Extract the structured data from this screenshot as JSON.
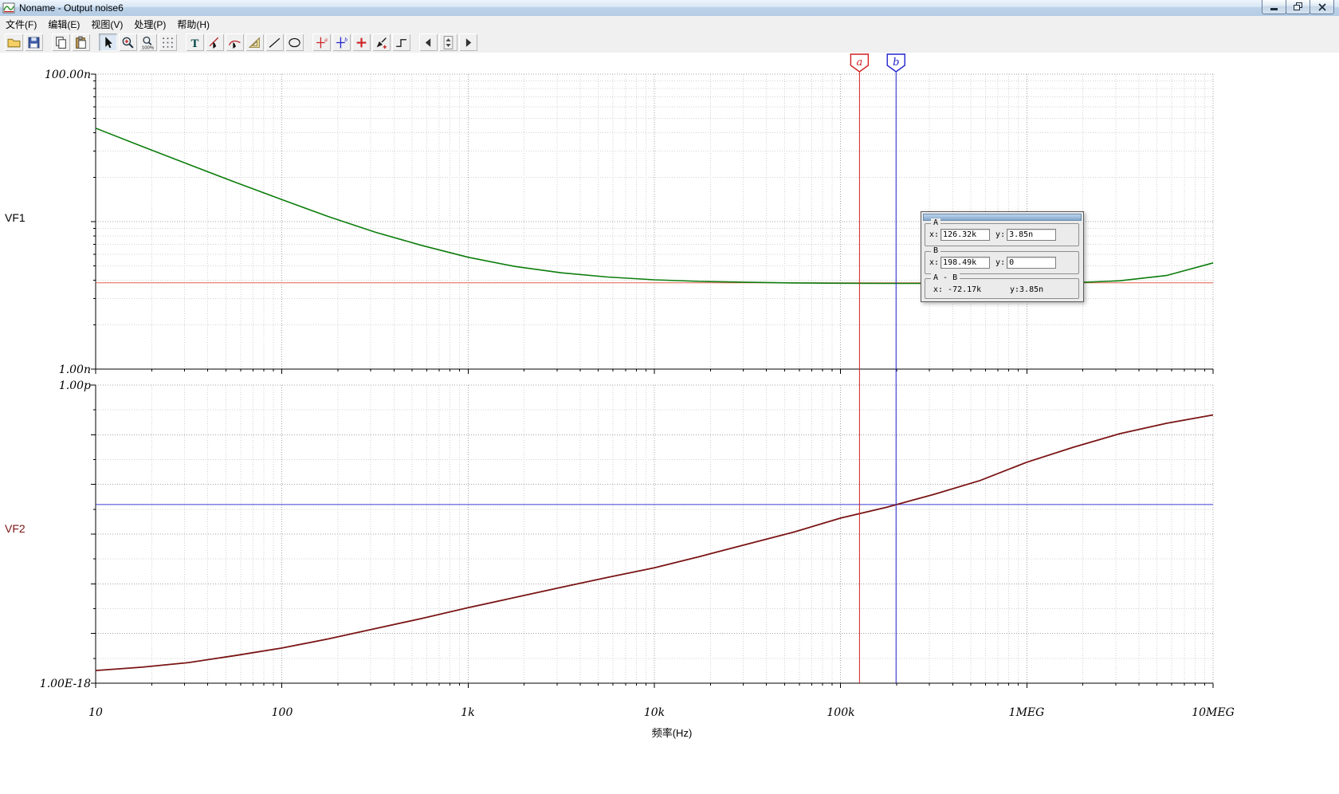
{
  "window": {
    "title": "Noname - Output noise6"
  },
  "menu": {
    "items": [
      {
        "id": "file",
        "label": "文件(F)"
      },
      {
        "id": "edit",
        "label": "编辑(E)"
      },
      {
        "id": "view",
        "label": "视图(V)"
      },
      {
        "id": "process",
        "label": "处理(P)"
      },
      {
        "id": "help",
        "label": "帮助(H)"
      }
    ]
  },
  "toolbar": {
    "groups": [
      [
        {
          "name": "open-button",
          "icon": "folder"
        },
        {
          "name": "save-button",
          "icon": "floppy"
        }
      ],
      [
        {
          "name": "copy-button",
          "icon": "copy"
        },
        {
          "name": "paste-button",
          "icon": "paste"
        }
      ],
      [
        {
          "name": "select-tool-button",
          "icon": "arrow",
          "pressed": true
        },
        {
          "name": "zoom-in-button",
          "icon": "zoom-in"
        },
        {
          "name": "zoom-100-button",
          "icon": "zoom-100"
        },
        {
          "name": "grid-toggle-button",
          "icon": "grid"
        }
      ],
      [
        {
          "name": "text-tool-button",
          "icon": "text"
        },
        {
          "name": "cursor-line-tool-button",
          "icon": "pointer-line"
        },
        {
          "name": "cursor-trace-tool-button",
          "icon": "pointer-curve"
        },
        {
          "name": "ruler-tool-button",
          "icon": "ruler"
        },
        {
          "name": "line-tool-button",
          "icon": "line"
        },
        {
          "name": "ellipse-tool-button",
          "icon": "ellipse"
        }
      ],
      [
        {
          "name": "cursor-a-button",
          "icon": "cursor-a"
        },
        {
          "name": "cursor-b-button",
          "icon": "cursor-b"
        },
        {
          "name": "add-marker-button",
          "icon": "add-marker"
        },
        {
          "name": "pen-tool-button",
          "icon": "pen"
        },
        {
          "name": "step-tool-button",
          "icon": "step"
        }
      ],
      [
        {
          "name": "prev-page-button",
          "icon": "prev"
        },
        {
          "name": "page-spinner",
          "icon": "spinner"
        },
        {
          "name": "next-page-button",
          "icon": "next"
        }
      ]
    ]
  },
  "plots": {
    "vf1_label": "VF1",
    "vf2_label": "VF2",
    "y_labels": {
      "vf1_top": "100.00n",
      "vf1_bottom": "1.00n",
      "vf2_top": "1.00p",
      "vf2_bottom": "1.00E-18"
    },
    "x_ticks": [
      "10",
      "100",
      "1k",
      "10k",
      "100k",
      "1MEG",
      "10MEG"
    ],
    "x_label": "频率(Hz)"
  },
  "cursors": {
    "a": {
      "label": "a",
      "freq": 126320,
      "value": 3.85e-09,
      "color": "#d02020",
      "hline_color": "#e0614f"
    },
    "b": {
      "label": "b",
      "freq": 198490,
      "value": 3.94e-15,
      "color": "#2424cf",
      "hline_color": "#3c3cd6"
    }
  },
  "cursor_panel": {
    "a": {
      "label": "A",
      "x_label": "x:",
      "x": "126.32k",
      "y_label": "y:",
      "y": "3.85n"
    },
    "b": {
      "label": "B",
      "x_label": "x:",
      "x": "198.49k",
      "y_label": "y:",
      "y": "0"
    },
    "diff": {
      "label": "A - B",
      "x_text": "x: -72.17k",
      "y_text": "y:3.85n"
    }
  },
  "chart_data": [
    {
      "type": "line",
      "title": "VF1 output noise spectral density",
      "x_scale": "log",
      "y_scale": "log",
      "x_range": [
        10,
        10000000
      ],
      "y_range": [
        1e-09,
        1e-07
      ],
      "x_ticks": [
        "10",
        "100",
        "1k",
        "10k",
        "100k",
        "1MEG",
        "10MEG"
      ],
      "y_ticks": [
        "1.00n",
        "100.00n"
      ],
      "xlabel": "频率(Hz)",
      "ylabel": "VF1",
      "grid": "log-dotted",
      "series": [
        {
          "name": "VF1",
          "color": "#0c7d0c",
          "x": [
            10,
            17.8,
            31.6,
            56.2,
            100,
            178,
            316,
            562,
            1000,
            1780,
            3160,
            5620,
            10000,
            17800,
            31600,
            56200,
            100000,
            178000,
            316000,
            562000,
            1000000,
            1780000,
            3160000,
            5620000,
            10000000
          ],
          "y": [
            4.3e-08,
            3.23e-08,
            2.44e-08,
            1.85e-08,
            1.41e-08,
            1.08e-08,
            8.5e-09,
            6.9e-09,
            5.73e-09,
            4.97e-09,
            4.5e-09,
            4.21e-09,
            4.03e-09,
            3.93e-09,
            3.88e-09,
            3.84e-09,
            3.82e-09,
            3.81e-09,
            3.81e-09,
            3.81e-09,
            3.82e-09,
            3.85e-09,
            3.97e-09,
            4.31e-09,
            5.25e-09
          ]
        }
      ],
      "annotations": {
        "cursor_a_x": 126320,
        "cursor_b_x": 198490,
        "hline_y": 3.85e-09
      }
    },
    {
      "type": "line",
      "title": "VF2 total output noise",
      "x_scale": "log",
      "y_scale": "log",
      "x_range": [
        10,
        10000000
      ],
      "y_range": [
        1e-18,
        1e-12
      ],
      "x_ticks": [
        "10",
        "100",
        "1k",
        "10k",
        "100k",
        "1MEG",
        "10MEG"
      ],
      "y_ticks": [
        "1.00E-18",
        "1.00p"
      ],
      "xlabel": "频率(Hz)",
      "ylabel": "VF2",
      "grid": "half-decade-dotted",
      "series": [
        {
          "name": "VF2",
          "color": "#7a1414",
          "x": [
            10,
            17.8,
            31.6,
            56.2,
            100,
            178,
            316,
            562,
            1000,
            1780,
            3160,
            5620,
            10000,
            17800,
            31600,
            56200,
            100000,
            178000,
            316000,
            562000,
            1000000,
            1780000,
            3160000,
            5620000,
            10000000
          ],
          "y": [
            1.8e-18,
            2.1e-18,
            2.6e-18,
            3.6e-18,
            5.1e-18,
            7.8e-18,
            1.25e-17,
            2e-17,
            3.3e-17,
            5.3e-17,
            8.5e-17,
            1.35e-16,
            2.1e-16,
            3.6e-16,
            6.3e-16,
            1.1e-15,
            2.1e-15,
            3.5e-15,
            6.3e-15,
            1.2e-14,
            2.8e-14,
            5.6e-14,
            1.05e-13,
            1.7e-13,
            2.5e-13
          ]
        }
      ],
      "annotations": {
        "cursor_a_x": 126320,
        "cursor_b_x": 198490,
        "hline_y": 3.94e-15
      }
    }
  ]
}
